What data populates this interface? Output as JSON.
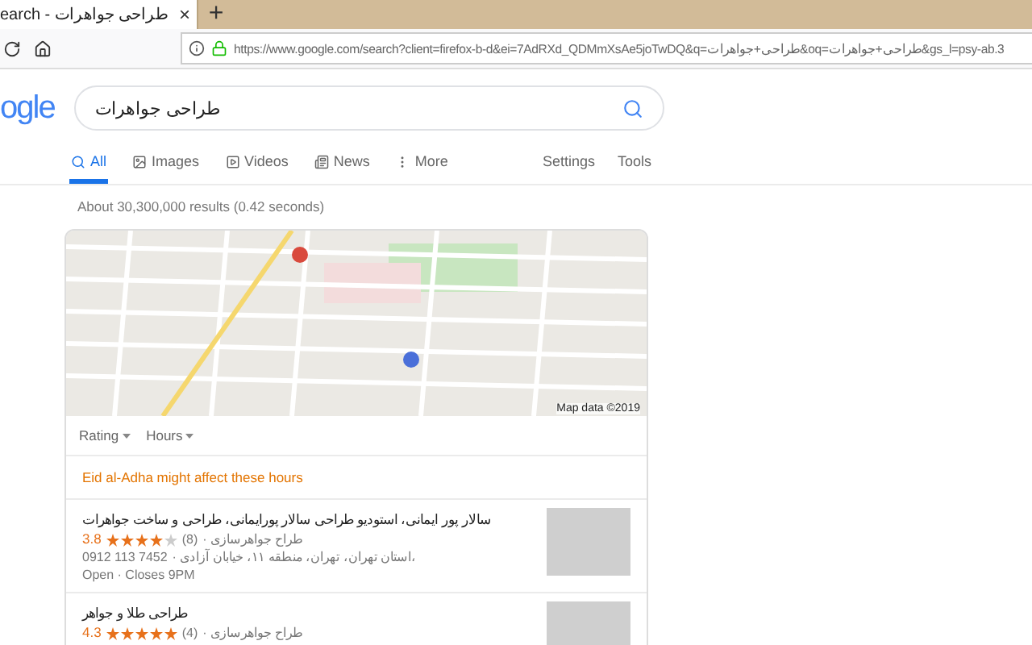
{
  "browser": {
    "tab": {
      "title": "earch - طراحی جواهرات",
      "close": "×"
    },
    "new_tab": "+",
    "url": "https://www.google.com/search?client=firefox-b-d&ei=7AdRXd_QDMmXsAe5joTwDQ&q=طراحی+جواهرات&oq=طراحی+جواهرات&gs_l=psy-ab.3"
  },
  "logo": "ogle",
  "search": {
    "value": "طراحی جواهرات"
  },
  "tabs": [
    {
      "label": "All",
      "selected": true
    },
    {
      "label": "Images",
      "selected": false
    },
    {
      "label": "Videos",
      "selected": false
    },
    {
      "label": "News",
      "selected": false
    },
    {
      "label": "More",
      "selected": false
    }
  ],
  "tools": [
    "Settings",
    "Tools"
  ],
  "result_stats": "About 30,300,000 results (0.42 seconds)",
  "map": {
    "attribution": "Map data ©2019"
  },
  "filters": [
    "Rating",
    "Hours"
  ],
  "notice": "Eid al-Adha might affect these hours",
  "places": [
    {
      "name": "سالار پور ایمانی، استودیو طراحی سالار پورایمانی، طراحی و ساخت جواهرات",
      "rating": "3.8",
      "stars": 4,
      "reviews": "(8)",
      "category": "· طراح جواهرسازی",
      "phone": "0912 113 7452",
      "address": "· استان تهران، تهران، منطقه ۱۱، خیابان آزادی،",
      "hours": "Open · Closes 9PM"
    },
    {
      "name": "طراحی طلا و جواهر",
      "rating": "4.3",
      "stars": 5,
      "reviews": "(4)",
      "category": "· طراح جواهرسازی"
    }
  ]
}
